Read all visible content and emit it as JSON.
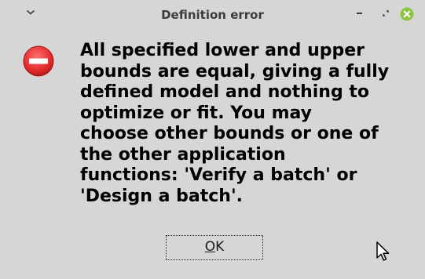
{
  "window": {
    "title": "Definition error"
  },
  "titlebar": {
    "icons": [
      "chevron-down-icon",
      "minimize-icon",
      "restore-icon",
      "close-icon"
    ],
    "close_color": "#8cc63f"
  },
  "dialog": {
    "icon": "error-icon",
    "icon_color": "#e32c2c",
    "message_lines": [
      "All specified lower and upper",
      "bounds are equal, giving a fully",
      "defined model and nothing to",
      "optimize or fit. You may",
      "choose other bounds or one of",
      "the other application",
      "functions: 'Verify a batch' or",
      "'Design a batch'."
    ]
  },
  "buttons": {
    "ok_mnemonic": "O",
    "ok_rest": "K"
  }
}
